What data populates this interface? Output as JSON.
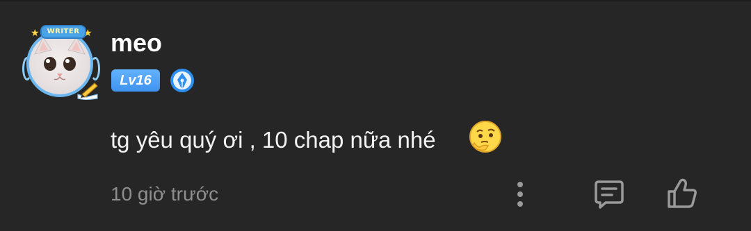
{
  "comment": {
    "username": "meo",
    "level": "Lv16",
    "avatar_frame_label": "WRITER",
    "text": "tg yêu quý ơi , 10 chap nữa nhé",
    "timestamp": "10 giờ trước"
  },
  "icons": {
    "avatar": "cat-avatar",
    "writer_badge": "pen-nib-badge-icon",
    "emoji": "thinking-face-emoji",
    "more": "vertical-dots-icon",
    "reply": "comment-bubble-icon",
    "like": "thumbs-up-icon"
  },
  "colors": {
    "background": "#262626",
    "username": "#ffffff",
    "text": "#f2f2f2",
    "timestamp": "#8f8f8f",
    "level_badge": "#4aa0f5",
    "icon": "#9a9a9a"
  }
}
